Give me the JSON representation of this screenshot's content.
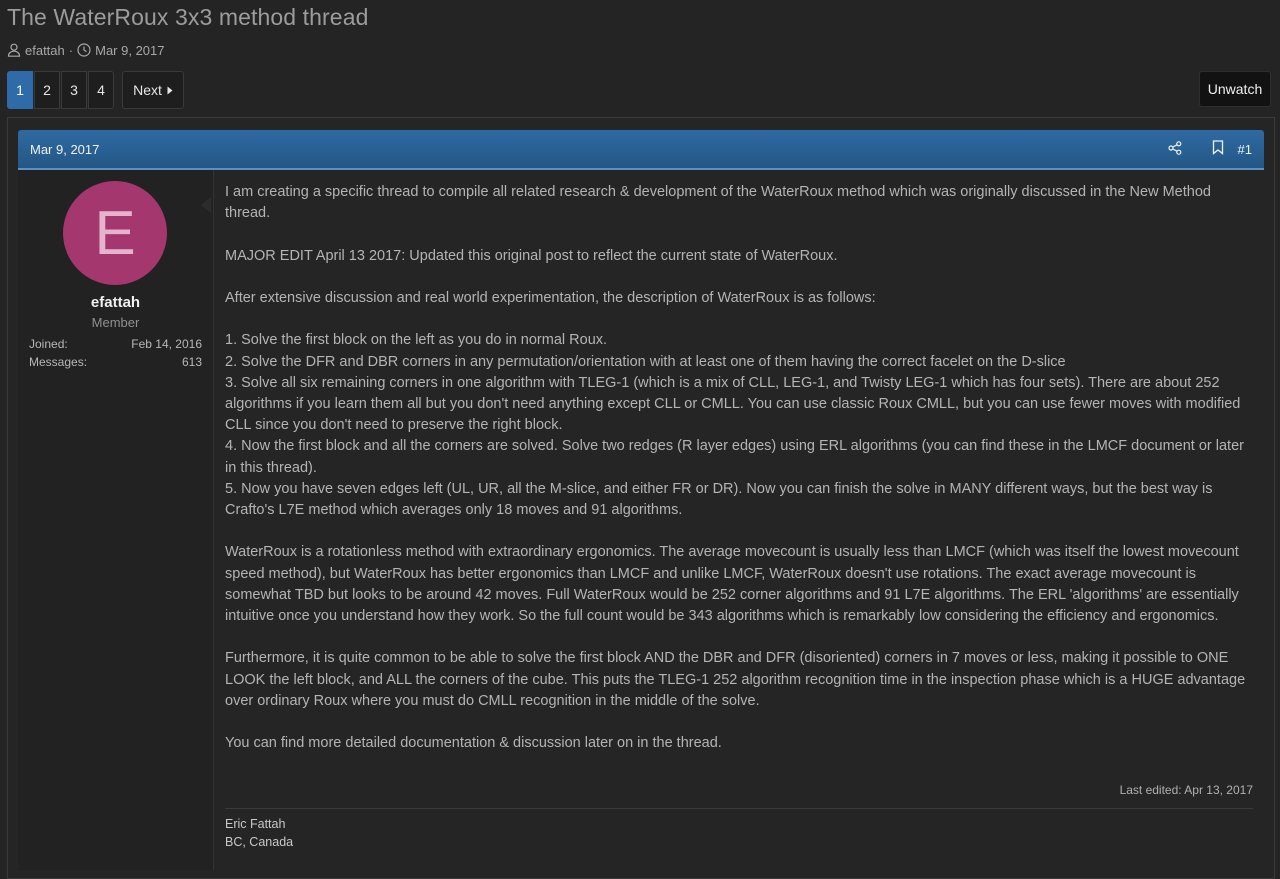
{
  "thread": {
    "title": "The WaterRoux 3x3 method thread",
    "author": "efattah",
    "date": "Mar 9, 2017",
    "separator": "·"
  },
  "pagination": {
    "pages": [
      "1",
      "2",
      "3",
      "4"
    ],
    "active_page": "1",
    "next_label": "Next"
  },
  "unwatch_label": "Unwatch",
  "post": {
    "date": "Mar 9, 2017",
    "number": "#1",
    "user": {
      "avatar_letter": "E",
      "avatar_color": "#a4376e",
      "name": "efattah",
      "title": "Member",
      "joined_label": "Joined:",
      "joined_value": "Feb 14, 2016",
      "messages_label": "Messages:",
      "messages_value": "613"
    },
    "paragraphs": [
      "I am creating a specific thread to compile all related research & development of the WaterRoux method which was originally discussed in the New Method thread.",
      "MAJOR EDIT April 13 2017: Updated this original post to reflect the current state of WaterRoux.",
      "After extensive discussion and real world experimentation, the description of WaterRoux is as follows:"
    ],
    "steps": [
      "1. Solve the first block on the left as you do in normal Roux.",
      "2. Solve the DFR and DBR corners in any permutation/orientation with at least one of them having the correct facelet on the D-slice",
      "3. Solve all six remaining corners in one algorithm with TLEG-1 (which is a mix of CLL, LEG-1, and Twisty LEG-1 which has four sets). There are about 252 algorithms if you learn them all but you don't need anything except CLL or CMLL. You can use classic Roux CMLL, but you can use fewer moves with modified CLL since you don't need to preserve the right block.",
      "4. Now the first block and all the corners are solved. Solve two redges (R layer edges) using ERL algorithms (you can find these in the LMCF document or later in this thread).",
      "5. Now you have seven edges left (UL, UR, all the M-slice, and either FR or DR). Now you can finish the solve in MANY different ways, but the best way is Crafto's L7E method which averages only 18 moves and 91 algorithms."
    ],
    "paragraphs_after": [
      "WaterRoux is a rotationless method with extraordinary ergonomics. The average movecount is usually less than LMCF (which was itself the lowest movecount speed method), but WaterRoux has better ergonomics than LMCF and unlike LMCF, WaterRoux doesn't use rotations. The exact average movecount is somewhat TBD but looks to be around 42 moves. Full WaterRoux would be 252 corner algorithms and 91 L7E algorithms. The ERL 'algorithms' are essentially intuitive once you understand how they work. So the full count would be 343 algorithms which is remarkably low considering the efficiency and ergonomics.",
      "Furthermore, it is quite common to be able to solve the first block AND the DBR and DFR (disoriented) corners in 7 moves or less, making it possible to ONE LOOK the left block, and ALL the corners of the cube. This puts the TLEG-1 252 algorithm recognition time in the inspection phase which is a HUGE advantage over ordinary Roux where you must do CMLL recognition in the middle of the solve.",
      "You can find more detailed documentation & discussion later on in the thread."
    ],
    "last_edited": "Last edited: Apr 13, 2017",
    "signature": [
      "Eric Fattah",
      "BC, Canada"
    ]
  },
  "icons": {
    "author": "user-icon",
    "date": "clock-icon",
    "next": "caret-right-icon",
    "share": "share-icon",
    "bookmark": "bookmark-icon"
  },
  "colors": {
    "accent": "#2f6ba8",
    "background": "#242424"
  }
}
